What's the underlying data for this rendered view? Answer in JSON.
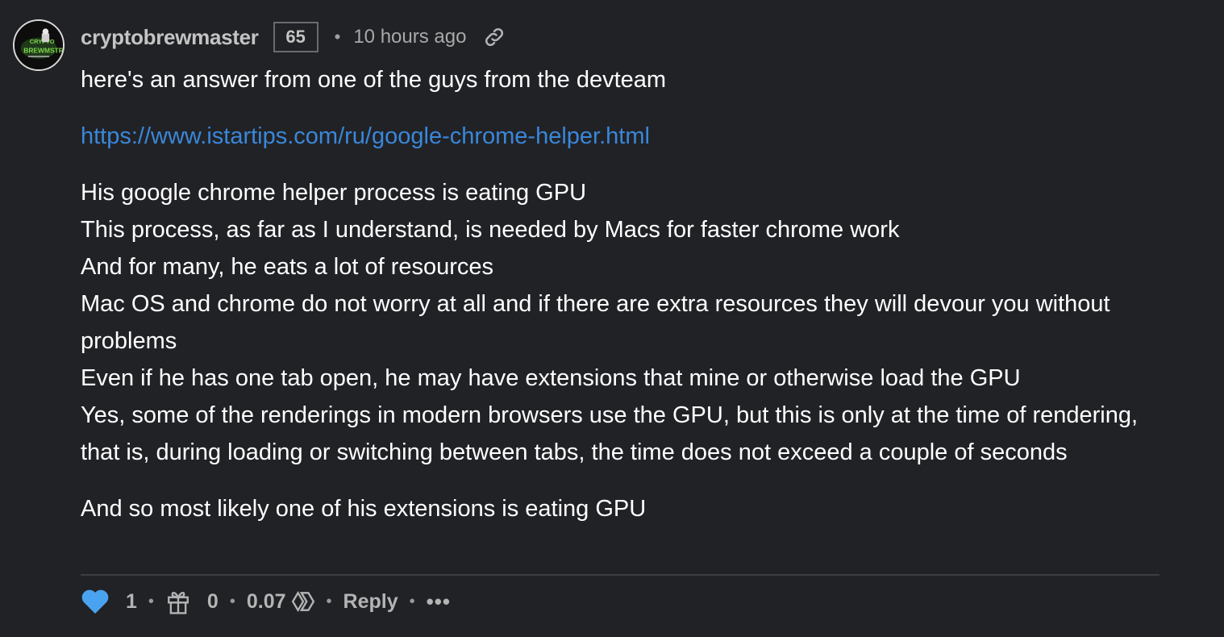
{
  "comment": {
    "author": "cryptobrewmaster",
    "reputation": "65",
    "time": "10 hours ago",
    "avatar_icon": "crypto-brewmaster-avatar-icon",
    "avatar_text": "CRYPTO BREWMASTER",
    "paragraphs": [
      "here's an answer from one of the guys from the devteam",
      "https://www.istartips.com/ru/google-chrome-helper.html",
      "His google chrome helper process is eating GPU",
      "This process, as far as I understand, is needed by Macs for faster chrome work",
      "And for many, he eats a lot of resources",
      "Mac OS and chrome do not worry at all and if there are extra resources they will devour you without problems",
      "Even if he has one tab open, he may have extensions that mine or otherwise load the GPU",
      "Yes, some of the renderings in modern browsers use the GPU, but this is only at the time of rendering, that is, during loading or switching between tabs, the time does not exceed a couple of seconds",
      "And so most likely one of his extensions is eating GPU"
    ]
  },
  "actions": {
    "votes": "1",
    "gifts": "0",
    "payout": "0.07",
    "reply_label": "Reply",
    "more_label": "•••"
  },
  "colors": {
    "background": "#212226",
    "link": "#3a87d9",
    "heart": "#4aa3ef",
    "text": "#ffffff",
    "muted": "#b4b4b4"
  },
  "icons": {
    "heart": "heart-icon",
    "gift": "gift-icon",
    "hive": "hive-logo-icon",
    "permalink": "link-icon"
  }
}
